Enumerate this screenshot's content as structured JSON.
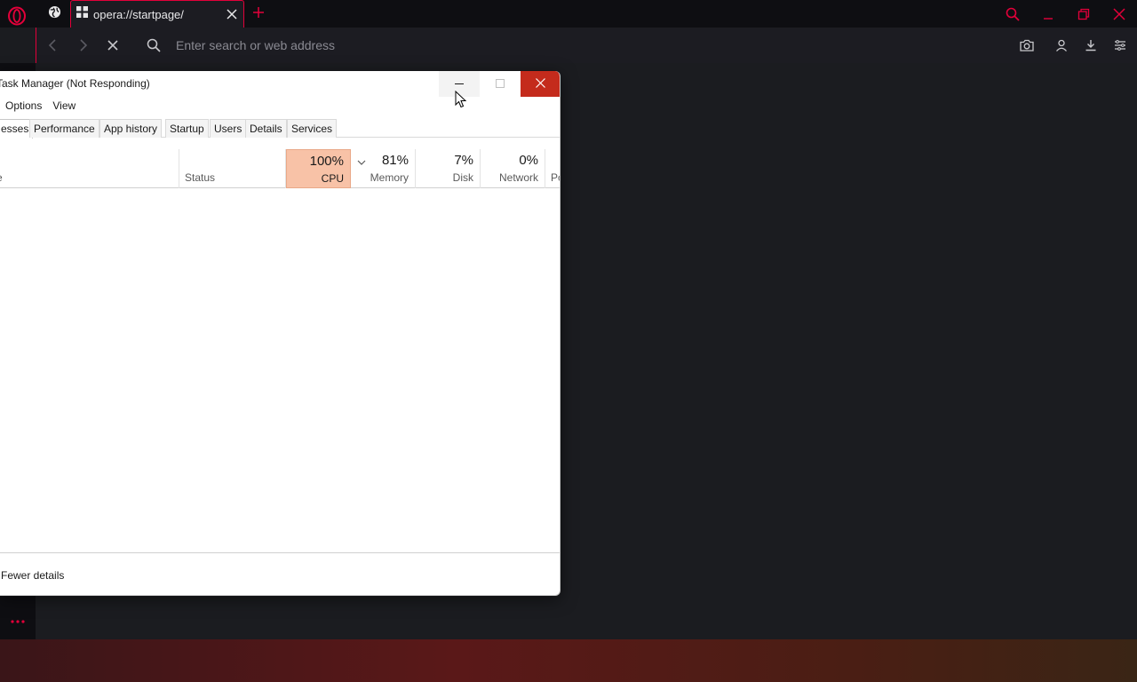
{
  "browser": {
    "tab_title": "opera://startpage/",
    "address_placeholder": "Enter search or web address",
    "accent_color": "#e3003a",
    "icons": [
      "opera-logo-icon",
      "globe-icon",
      "grid-icon",
      "close-icon",
      "plus-icon",
      "search-icon",
      "minimize-icon",
      "restore-icon",
      "back-icon",
      "forward-icon",
      "stop-icon",
      "camera-icon",
      "account-icon",
      "download-icon",
      "menu-icon",
      "more-icon"
    ]
  },
  "taskmgr": {
    "title": "Task Manager (Not Responding)",
    "menu": [
      "Options",
      "View"
    ],
    "tabs": [
      "esses",
      "Performance",
      "App history",
      "Startup",
      "Users",
      "Details",
      "Services"
    ],
    "columns": {
      "name": "e",
      "status": "Status",
      "cpu": {
        "pct": "100%",
        "label": "CPU"
      },
      "memory": {
        "pct": "81%",
        "label": "Memory"
      },
      "disk": {
        "pct": "7%",
        "label": "Disk"
      },
      "network": {
        "pct": "0%",
        "label": "Network"
      },
      "power": "Po"
    },
    "footer": "Fewer details",
    "close_color": "#c42b1c",
    "cpu_highlight_color": "#f8c2a7"
  }
}
